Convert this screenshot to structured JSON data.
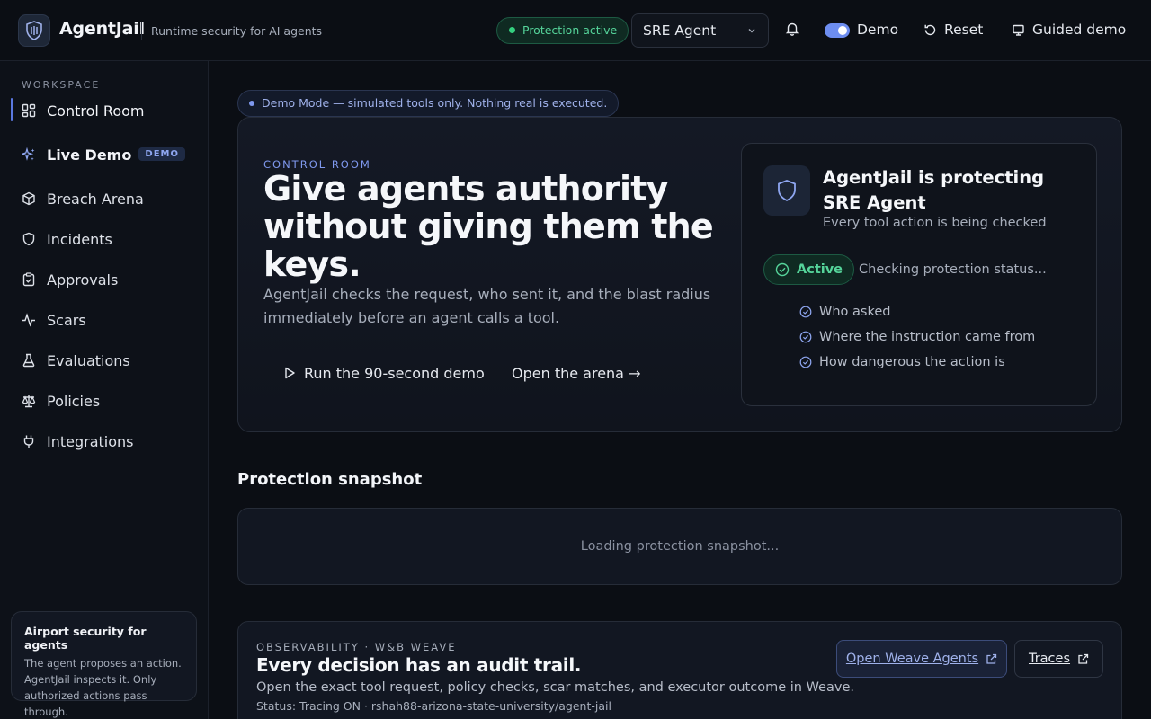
{
  "header": {
    "brand": "AgentJail",
    "tagline": "Runtime security for AI agents",
    "protection_status": "Protection active",
    "agent_select": "SRE Agent",
    "demo_toggle_label": "Demo",
    "reset_label": "Reset",
    "guided_demo_label": "Guided demo"
  },
  "sidebar": {
    "section_label": "WORKSPACE",
    "items": [
      {
        "label": "Control Room",
        "icon": "grid-icon"
      },
      {
        "label": "Live Demo",
        "icon": "sparkles-icon",
        "badge": "DEMO"
      },
      {
        "label": "Breach Arena",
        "icon": "cube-icon"
      },
      {
        "label": "Incidents",
        "icon": "shield-icon"
      },
      {
        "label": "Approvals",
        "icon": "clipboard-check-icon"
      },
      {
        "label": "Scars",
        "icon": "activity-icon"
      },
      {
        "label": "Evaluations",
        "icon": "flask-icon"
      },
      {
        "label": "Policies",
        "icon": "scale-icon"
      },
      {
        "label": "Integrations",
        "icon": "plug-icon"
      }
    ],
    "card": {
      "title": "Airport security for agents",
      "text": "The agent proposes an action. AgentJail inspects it. Only authorized actions pass through."
    }
  },
  "banner": "Demo Mode — simulated tools only. Nothing real is executed.",
  "hero": {
    "eyebrow": "CONTROL ROOM",
    "title": "Give agents authority without giving them the keys.",
    "description": "AgentJail checks the request, who sent it, and the blast radius immediately before an agent calls a tool.",
    "primary_button": "Run the 90-second demo",
    "secondary_button": "Open the arena →"
  },
  "status_card": {
    "title": "AgentJail is protecting SRE Agent",
    "subtitle": "Every tool action is being checked",
    "active_label": "Active",
    "checking_text": "Checking protection status...",
    "checks": [
      "Who asked",
      "Where the instruction came from",
      "How dangerous the action is"
    ]
  },
  "snapshot": {
    "title": "Protection snapshot",
    "loading_text": "Loading protection snapshot..."
  },
  "observability": {
    "eyebrow": "OBSERVABILITY · W&B WEAVE",
    "title": "Every decision has an audit trail.",
    "description": "Open the exact tool request, policy checks, scar matches, and executor outcome in Weave.",
    "status": "Status: Tracing ON · rshah88-arizona-state-university/agent-jail",
    "weave_button": "Open Weave Agents",
    "traces_button": "Traces"
  },
  "colors": {
    "background": "#0b0e14",
    "accent": "#7f98ee",
    "success": "#55d49a"
  }
}
